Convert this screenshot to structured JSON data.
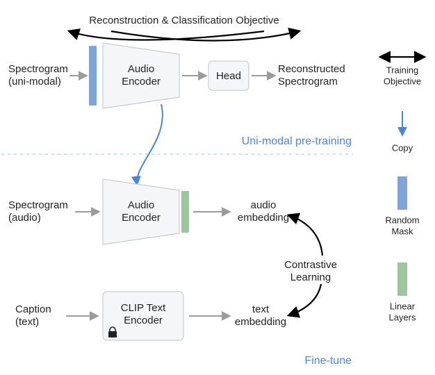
{
  "top": {
    "objective": "Reconstruction & Classification Objective",
    "input_l1": "Spectrogram",
    "input_l2": "(uni-modal)",
    "encoder_l1": "Audio",
    "encoder_l2": "Encoder",
    "head": "Head",
    "output_l1": "Reconstructed",
    "output_l2": "Spectrogram",
    "stage_label": "Uni-modal pre-training"
  },
  "bottom": {
    "audio_in_l1": "Spectrogram",
    "audio_in_l2": "(audio)",
    "audio_enc_l1": "Audio",
    "audio_enc_l2": "Encoder",
    "audio_emb_l1": "audio",
    "audio_emb_l2": "embedding",
    "text_in_l1": "Caption",
    "text_in_l2": "(text)",
    "text_enc_l1": "CLIP Text",
    "text_enc_l2": "Encoder",
    "text_emb_l1": "text",
    "text_emb_l2": "embedding",
    "contrastive_l1": "Contrastive",
    "contrastive_l2": "Learning",
    "stage_label": "Fine-tune"
  },
  "legend": {
    "training_l1": "Training",
    "training_l2": "Objective",
    "copy": "Copy",
    "mask_l1": "Random",
    "mask_l2": "Mask",
    "linear_l1": "Linear",
    "linear_l2": "Layers"
  },
  "icons": {
    "lock": "lock"
  }
}
